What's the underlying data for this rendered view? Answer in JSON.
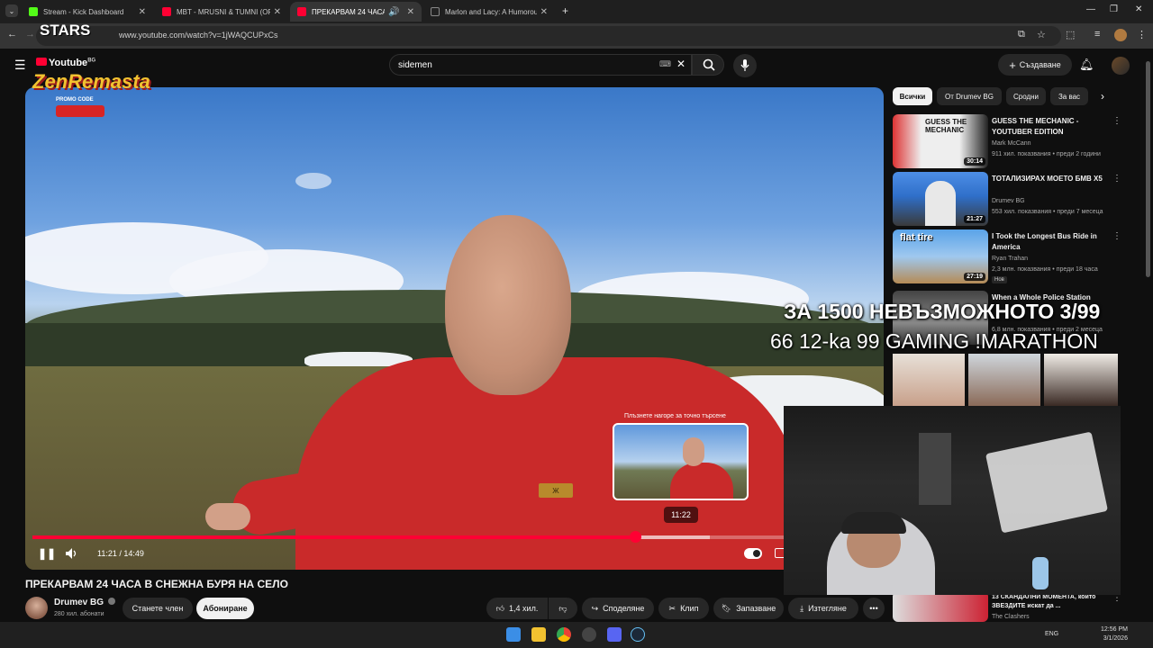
{
  "browser": {
    "tabs": [
      {
        "title": "Stream - Kick Dashboard",
        "favicon_color": "#53fc18"
      },
      {
        "title": "MBT - MRUSNI & TUMNI (OFFI",
        "favicon_color": "#ff0033"
      },
      {
        "title": "ПРЕКАРВАМ 24 ЧАСА В СН",
        "favicon_color": "#ff0033"
      },
      {
        "title": "Marlon and Lacy: A Humorous",
        "favicon_color": "#ffffff"
      }
    ],
    "new_tab": "+",
    "url": "www.youtube.com/watch?v=1jWAQCUPxCs"
  },
  "youtube": {
    "search_query": "sidemen",
    "create_label": "Създаване",
    "video": {
      "title": "ПРЕКАРВАМ 24 ЧАСА В СНЕЖНА БУРЯ НА СЕЛО",
      "current_time": "11:21",
      "duration": "14:49",
      "progress_fraction": 0.8,
      "buffer_fraction": 0.9,
      "preview_time": "11:22",
      "preview_hint": "Плъзнете нагоре за точно търсене",
      "jacket_badge": "Ж"
    },
    "channel": {
      "name": "Drumev BG",
      "subscribers": "280 хил. абонати",
      "join_label": "Станете член",
      "subscribe_label": "Абониране"
    },
    "actions": {
      "likes": "1,4 хил.",
      "share": "Споделяне",
      "clip": "Клип",
      "save": "Запазване",
      "download": "Изтегляне"
    },
    "chips": [
      "Всички",
      "От Drumev BG",
      "Сродни",
      "За вас"
    ],
    "recommendations": [
      {
        "title": "GUESS THE MECHANIC - YOUTUBER EDITION",
        "channel": "Mark McCann",
        "meta": "911 хил. показвания • преди 2 години",
        "duration": "30:14",
        "thumb_text": "GUESS THE MECHANIC",
        "badge": ""
      },
      {
        "title": "ТОТАЛИЗИРАХ МОЕТО БМВ X5",
        "channel": "Drumev BG",
        "meta": "553 хил. показвания • преди 7 месеца",
        "duration": "21:27",
        "thumb_text": "",
        "badge": ""
      },
      {
        "title": "I Took the Longest Bus Ride in America",
        "channel": "Ryan Trahan",
        "meta": "2,3 млн. показвания • преди 18 часа",
        "duration": "27:19",
        "thumb_text": "flat tire",
        "badge": "Нов"
      },
      {
        "title": "When a Whole Police Station",
        "channel": "",
        "meta": "6,8 млн. показвания • преди 2 месеца",
        "duration": "",
        "thumb_text": "",
        "badge": ""
      },
      {
        "title": "13 СКАНДАЛНИ МОМЕНТА, които ЗВЕЗДИТЕ искат да ...",
        "channel": "The Clashers",
        "meta": "",
        "duration": "",
        "thumb_text": "",
        "badge": ""
      }
    ]
  },
  "stream_overlay": {
    "line1": "ЗА 1500 НЕВЪЗМОЖНОТО 3/99",
    "line2": "66 12-ka 99 GAMING !MARATHON",
    "logo_stars": "STARS",
    "logo_youtube": "Youtube",
    "logo_youtube_badge": "BG",
    "logo_zen": "ZenRemasta",
    "logo_promo": "PROMO CODE"
  },
  "taskbar": {
    "language": "ENG",
    "time": "12:56 PM",
    "date": "3/1/2026"
  }
}
